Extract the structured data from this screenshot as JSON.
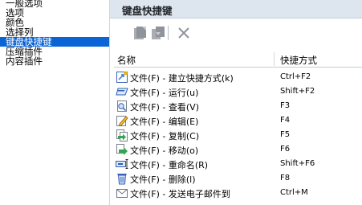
{
  "nav": {
    "items": [
      {
        "label": "一般选项",
        "selected": false
      },
      {
        "label": "选项",
        "selected": false
      },
      {
        "label": "颜色",
        "selected": false
      },
      {
        "label": "选择列",
        "selected": false
      },
      {
        "label": "键盘快捷键",
        "selected": true
      },
      {
        "label": "压缩插件",
        "selected": false
      },
      {
        "label": "内容插件",
        "selected": false
      }
    ]
  },
  "panel": {
    "title": "键盘快捷键"
  },
  "toolbar": {
    "icons": [
      "add-shortcut-icon",
      "edit-shortcut-icon",
      "delete-shortcut-icon"
    ]
  },
  "table": {
    "columns": {
      "name": "名称",
      "shortcut": "快捷方式"
    },
    "rows": [
      {
        "name": "文件(F) - 建立快捷方式(k)",
        "shortcut": "Ctrl+F2",
        "icon": "create-shortcut-icon"
      },
      {
        "name": "文件(F) - 运行(u)",
        "shortcut": "Shift+F2",
        "icon": "run-icon"
      },
      {
        "name": "文件(F) - 查看(V)",
        "shortcut": "F3",
        "icon": "view-icon"
      },
      {
        "name": "文件(F) - 编辑(E)",
        "shortcut": "F4",
        "icon": "edit-icon"
      },
      {
        "name": "文件(F) - 复制(C)",
        "shortcut": "F5",
        "icon": "copy-icon"
      },
      {
        "name": "文件(F) - 移动(o)",
        "shortcut": "F6",
        "icon": "move-icon"
      },
      {
        "name": "文件(F) - 重命名(R)",
        "shortcut": "Shift+F6",
        "icon": "rename-icon"
      },
      {
        "name": "文件(F) - 删除(l)",
        "shortcut": "F8",
        "icon": "delete-icon"
      },
      {
        "name": "文件(F) - 发送电子邮件到",
        "shortcut": "Ctrl+M",
        "icon": "email-icon"
      }
    ]
  },
  "colors": {
    "selection": "#0a64d6",
    "header_bg": "#dde5ef"
  }
}
